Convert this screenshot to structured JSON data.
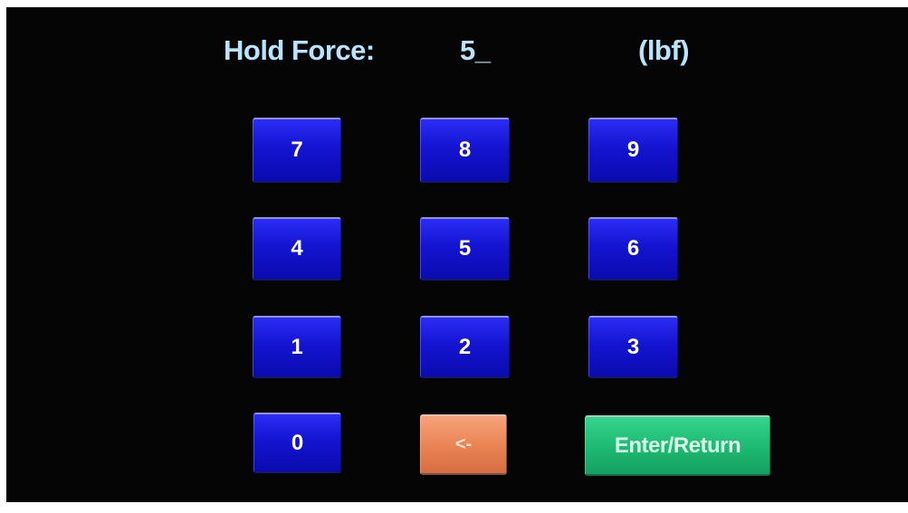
{
  "header": {
    "label": "Hold Force:",
    "value": "5_",
    "unit": "(lbf)"
  },
  "keypad": {
    "keys": [
      "7",
      "8",
      "9",
      "4",
      "5",
      "6",
      "1",
      "2",
      "3",
      "0"
    ],
    "backspace_label": "<-",
    "enter_label": "Enter/Return"
  },
  "colors": {
    "background": "#050505",
    "header_text": "#b9e4ff",
    "digit_key": "#1a1ad8",
    "backspace_key": "#ea8555",
    "enter_key": "#1db872"
  }
}
